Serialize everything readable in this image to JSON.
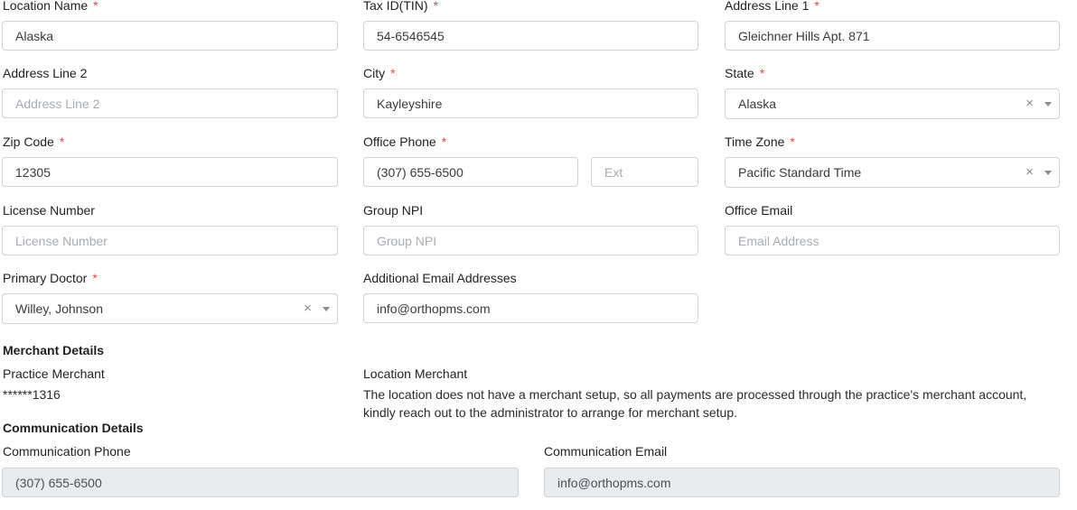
{
  "form": {
    "location_name": {
      "label": "Location Name",
      "value": "Alaska",
      "required": "*"
    },
    "tax_id": {
      "label": "Tax ID(TIN)",
      "value": "54-6546545",
      "required": "*"
    },
    "address_line1": {
      "label": "Address Line 1",
      "value": "Gleichner Hills Apt. 871",
      "required": "*"
    },
    "address_line2": {
      "label": "Address Line 2",
      "value": "",
      "placeholder": "Address Line 2"
    },
    "city": {
      "label": "City",
      "value": "Kayleyshire",
      "required": "*"
    },
    "state": {
      "label": "State",
      "value": "Alaska",
      "required": "*",
      "clear": "×"
    },
    "zip_code": {
      "label": "Zip Code",
      "value": "12305",
      "required": "*"
    },
    "office_phone": {
      "label": "Office Phone",
      "value": "(307) 655-6500",
      "required": "*",
      "ext_placeholder": "Ext"
    },
    "time_zone": {
      "label": "Time Zone",
      "value": "Pacific Standard Time",
      "required": "*",
      "clear": "×"
    },
    "license_number": {
      "label": "License Number",
      "value": "",
      "placeholder": "License Number"
    },
    "group_npi": {
      "label": "Group NPI",
      "value": "",
      "placeholder": "Group NPI"
    },
    "office_email": {
      "label": "Office Email",
      "value": "",
      "placeholder": "Email Address"
    },
    "primary_doctor": {
      "label": "Primary Doctor",
      "value": "Willey, Johnson",
      "required": "*",
      "clear": "×"
    },
    "additional_emails": {
      "label": "Additional Email Addresses",
      "value": "info@orthopms.com"
    }
  },
  "merchant": {
    "section_title": "Merchant Details",
    "practice_label": "Practice Merchant",
    "practice_value": "******1316",
    "location_label": "Location Merchant",
    "location_message": "The location does not have a merchant setup, so all payments are processed through the practice's merchant account, kindly reach out to the administrator to arrange for merchant setup."
  },
  "communication": {
    "section_title": "Communication Details",
    "phone_label": "Communication Phone",
    "phone_value": "(307) 655-6500",
    "email_label": "Communication Email",
    "email_value": "info@orthopms.com"
  }
}
